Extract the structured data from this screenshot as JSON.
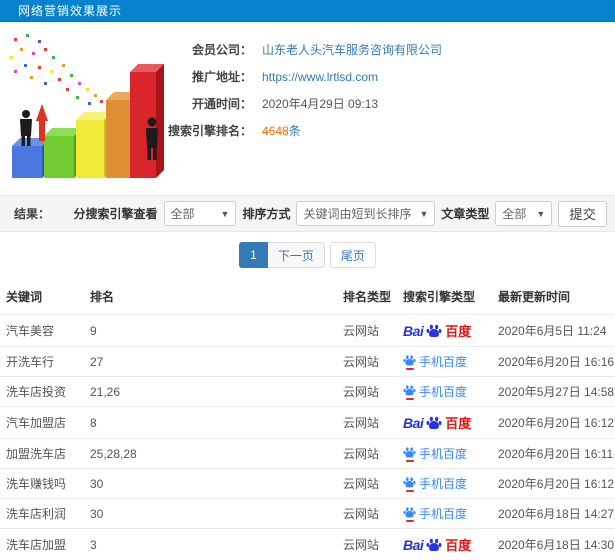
{
  "header": {
    "title": "网络营销效果展示"
  },
  "info": {
    "rows": [
      {
        "label": "会员公司：",
        "value": "山东老人头汽车服务咨询有限公司"
      },
      {
        "label": "推广地址：",
        "value": "https://www.lrtlsd.com"
      },
      {
        "label": "开通时间：",
        "value": "2020年4月29日 09:13"
      },
      {
        "label": "搜索引擎排名：",
        "value": "4648",
        "suffix": "条"
      }
    ]
  },
  "filters": {
    "result_label": "结果：",
    "engine_label": "分搜索引擎查看",
    "engine_value": "全部",
    "sort_label": "排序方式",
    "sort_value": "关键词由短到长排序",
    "type_label": "文章类型",
    "type_value": "全部",
    "submit_label": "提交"
  },
  "pagination": {
    "current": "1",
    "next": "下一页",
    "last": "尾页"
  },
  "table": {
    "headers": [
      "关键词",
      "排名",
      "排名类型",
      "搜索引擎类型",
      "最新更新时间"
    ],
    "rows": [
      {
        "keyword": "汽车美容",
        "rank": "9",
        "rank_type": "云网站",
        "engine": "baidu",
        "updated": "2020年6月5日 11:24"
      },
      {
        "keyword": "开洗车行",
        "rank": "27",
        "rank_type": "云网站",
        "engine": "baidu-mobile",
        "updated": "2020年6月20日 16:16"
      },
      {
        "keyword": "洗车店投资",
        "rank": "21,26",
        "rank_type": "云网站",
        "engine": "baidu-mobile",
        "updated": "2020年5月27日 14:58"
      },
      {
        "keyword": "汽车加盟店",
        "rank": "8",
        "rank_type": "云网站",
        "engine": "baidu",
        "updated": "2020年6月20日 16:12"
      },
      {
        "keyword": "加盟洗车店",
        "rank": "25,28,28",
        "rank_type": "云网站",
        "engine": "baidu-mobile",
        "updated": "2020年6月20日 16:11"
      },
      {
        "keyword": "洗车赚钱吗",
        "rank": "30",
        "rank_type": "云网站",
        "engine": "baidu-mobile",
        "updated": "2020年6月20日 16:12"
      },
      {
        "keyword": "洗车店利润",
        "rank": "30",
        "rank_type": "云网站",
        "engine": "baidu-mobile",
        "updated": "2020年6月18日 14:27"
      },
      {
        "keyword": "洗车店加盟",
        "rank": "3",
        "rank_type": "云网站",
        "engine": "baidu",
        "updated": "2020年6月18日 14:30"
      }
    ]
  },
  "engine_labels": {
    "baidu_text": "Bai",
    "baidu_cn": "百度",
    "mobile_cn": "手机百度"
  },
  "colors": {
    "topbar_blue": "#0782cd",
    "link_blue": "#337ab7",
    "highlight_orange": "#ff6600",
    "baidu_blue": "#2534dc",
    "baidu_red": "#de1515",
    "mobile_blue": "#3388ff"
  }
}
